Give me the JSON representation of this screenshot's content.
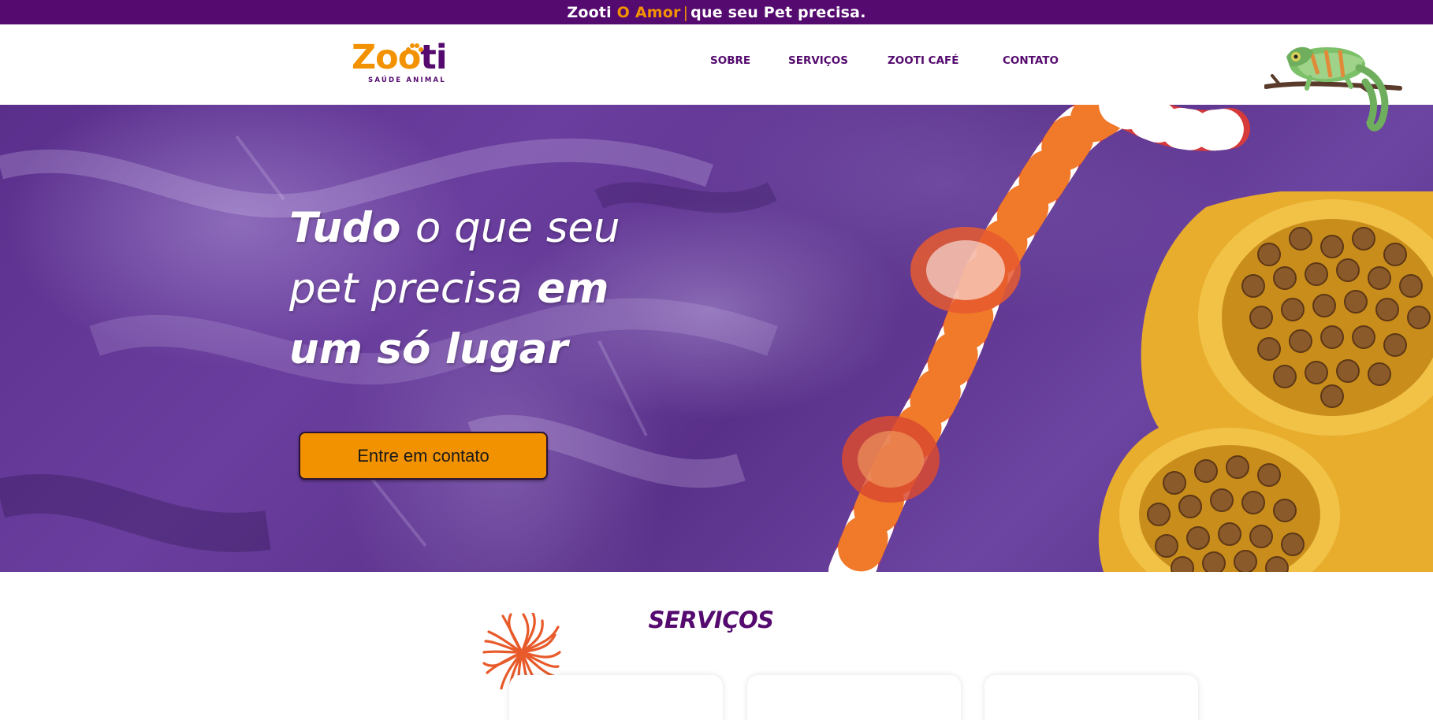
{
  "topbar": {
    "brand": "Zooti",
    "accent": "O Amor",
    "separator": "|",
    "rest": "que seu Pet precisa."
  },
  "header": {
    "logo": {
      "word_part1": "Zoo",
      "word_part2": "ti",
      "tagline": "SAÚDE ANIMAL"
    },
    "nav": [
      {
        "label": "SOBRE"
      },
      {
        "label": "SERVIÇOS"
      },
      {
        "label": "ZOOTI CAFÉ"
      },
      {
        "label": "CONTATO"
      }
    ],
    "decor_icon": "chameleon-icon"
  },
  "hero": {
    "title": {
      "line1_bold": "Tudo",
      "line1_rest": "o que seu",
      "line2_rest": "pet precisa",
      "line2_bold": "em",
      "line3_bold": "um só lugar"
    },
    "cta_label": "Entre em contato"
  },
  "services": {
    "title": "SERVIÇOS"
  },
  "colors": {
    "brand_purple": "#540a6e",
    "brand_orange": "#f39200",
    "hero_purple": "#5a2f8c"
  }
}
